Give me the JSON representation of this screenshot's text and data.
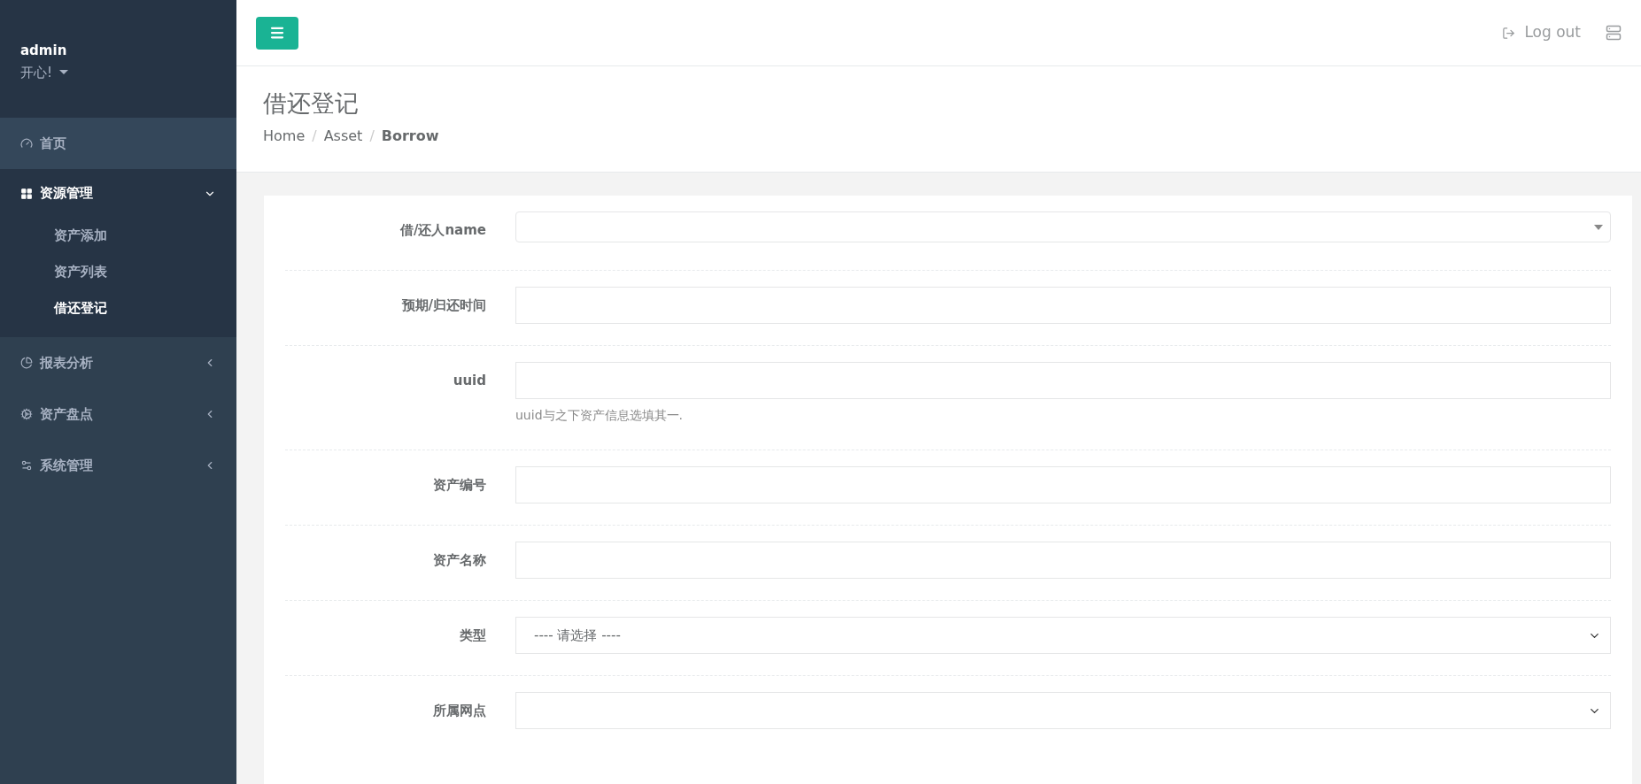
{
  "user": {
    "name": "admin",
    "status": "开心!"
  },
  "sidebar": {
    "items": [
      {
        "label": "首页",
        "selected": false,
        "expanded": false,
        "kind": "link"
      },
      {
        "label": "资源管理",
        "selected": false,
        "expanded": true,
        "kind": "group",
        "children": [
          {
            "label": "资产添加",
            "selected": false
          },
          {
            "label": "资产列表",
            "selected": false
          },
          {
            "label": "借还登记",
            "selected": true
          }
        ]
      },
      {
        "label": "报表分析",
        "selected": false,
        "expanded": false,
        "kind": "group"
      },
      {
        "label": "资产盘点",
        "selected": false,
        "expanded": false,
        "kind": "group"
      },
      {
        "label": "系统管理",
        "selected": false,
        "expanded": false,
        "kind": "group"
      }
    ]
  },
  "topbar": {
    "logout": "Log out"
  },
  "page": {
    "title": "借还登记",
    "breadcrumb": [
      {
        "label": "Home",
        "selected": false,
        "separator": "/"
      },
      {
        "label": "Asset",
        "selected": false,
        "separator": "/"
      },
      {
        "label": "Borrow",
        "selected": true
      }
    ]
  },
  "form": {
    "fields": [
      {
        "label": "借/还人name",
        "kind": "combo"
      },
      {
        "label": "预期/归还时间",
        "kind": "text"
      },
      {
        "label": "uuid",
        "kind": "text",
        "help": "uuid与之下资产信息选填其一."
      },
      {
        "label": "资产编号",
        "kind": "text"
      },
      {
        "label": "资产名称",
        "kind": "text"
      },
      {
        "label": "类型",
        "kind": "select",
        "value": "---- 请选择 ----"
      },
      {
        "label": "所属网点",
        "kind": "select"
      }
    ]
  }
}
